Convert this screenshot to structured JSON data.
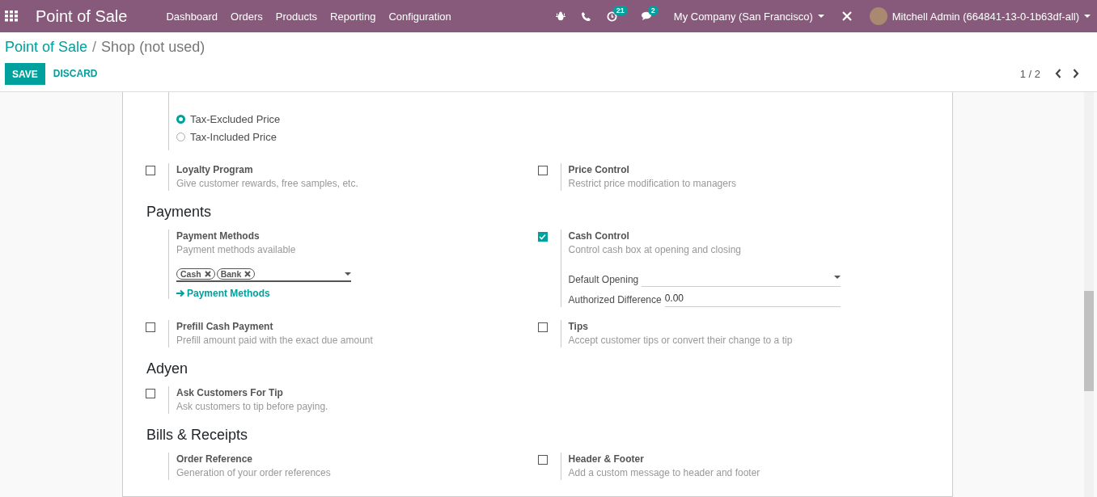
{
  "navbar": {
    "app_name": "Point of Sale",
    "menu": [
      "Dashboard",
      "Orders",
      "Products",
      "Reporting",
      "Configuration"
    ],
    "activity_count": "21",
    "message_count": "2",
    "company": "My Company (San Francisco)",
    "user": "Mitchell Admin (664841-13-0-1b63df-all)"
  },
  "breadcrumb": [
    "Point of Sale",
    "Shop (not used)"
  ],
  "breadcrumb_separator": "/",
  "buttons": {
    "save": "SAVE",
    "discard": "DISCARD"
  },
  "pager": "1 / 2",
  "form": {
    "rows": [
      {
        "kind": "settings",
        "left": {
          "kind": "radio",
          "options": [
            {
              "label": "Tax-Excluded Price",
              "selected": true
            },
            {
              "label": "Tax-Included Price",
              "selected": false
            }
          ]
        }
      },
      {
        "kind": "settings",
        "left": {
          "kind": "checkbox",
          "label": "Loyalty Program",
          "description": "Give customer rewards, free samples, etc.",
          "checked": false
        },
        "right": {
          "kind": "checkbox",
          "label": "Price Control",
          "description": "Restrict price modification to managers",
          "checked": false
        }
      },
      {
        "kind": "heading",
        "title": "Payments"
      },
      {
        "kind": "settings",
        "left": {
          "kind": "tags",
          "label": "Payment Methods",
          "description": "Payment methods available",
          "tags": [
            "Cash",
            "Bank"
          ],
          "link": "Payment Methods"
        },
        "right": {
          "kind": "checkbox",
          "label": "Cash Control",
          "description": "Control cash box at opening and closing",
          "checked": true,
          "fields": [
            {
              "kind": "select",
              "label": "Default Opening"
            },
            {
              "kind": "text",
              "label": "Authorized Difference",
              "value": "0.00"
            }
          ]
        }
      },
      {
        "kind": "settings",
        "left": {
          "kind": "checkbox",
          "label": "Prefill Cash Payment",
          "description": "Prefill amount paid with the exact due amount",
          "checked": false
        },
        "right": {
          "kind": "checkbox",
          "label": "Tips",
          "description": "Accept customer tips or convert their change to a tip",
          "checked": false
        }
      },
      {
        "kind": "heading",
        "title": "Adyen"
      },
      {
        "kind": "settings",
        "left": {
          "kind": "checkbox",
          "label": "Ask Customers For Tip",
          "description": "Ask customers to tip before paying.",
          "checked": false
        }
      },
      {
        "kind": "heading",
        "title": "Bills & Receipts"
      },
      {
        "kind": "settings",
        "left": {
          "kind": "plain",
          "label": "Order Reference",
          "description": "Generation of your order references"
        },
        "right": {
          "kind": "checkbox",
          "label": "Header & Footer",
          "description": "Add a custom message to header and footer",
          "checked": false
        }
      }
    ]
  }
}
